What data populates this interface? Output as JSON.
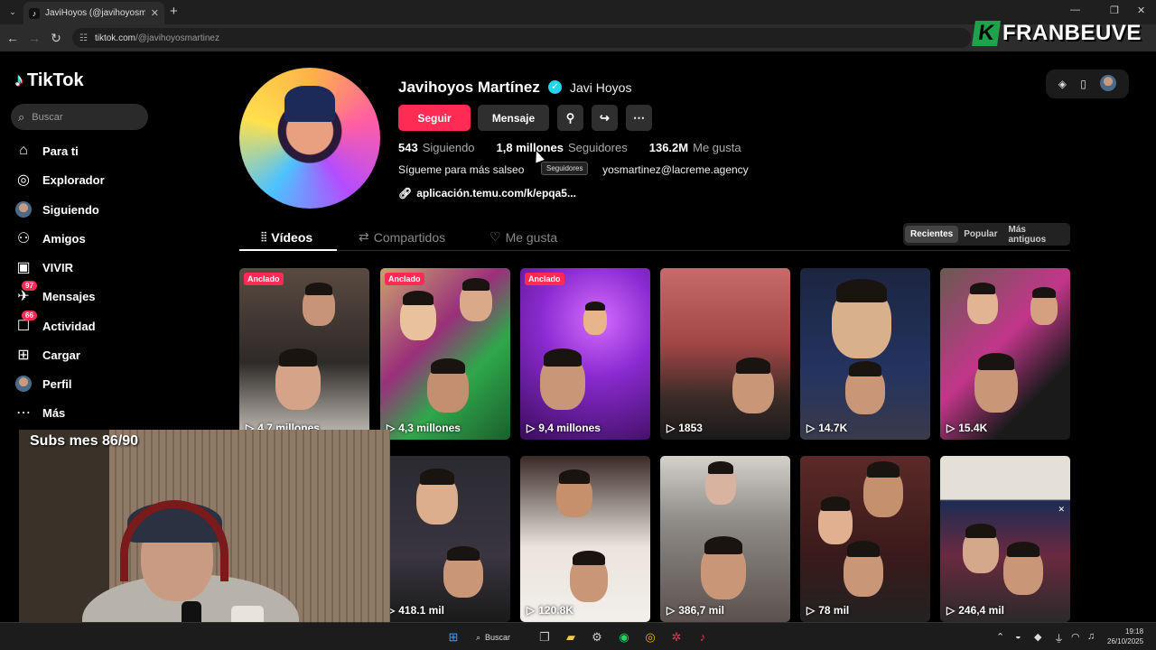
{
  "browser": {
    "tab_title": "JaviHoyos (@javihoyosmartinez",
    "url_host": "tiktok.com",
    "url_path": "/@javihoyosmartinez"
  },
  "overlay_brand": {
    "letter": "K",
    "name": "FRANBEUVE",
    "accent": "#1ea34a"
  },
  "sidebar": {
    "logo": "TikTok",
    "search_placeholder": "Buscar",
    "items": [
      {
        "label": "Para ti",
        "icon": "home-icon"
      },
      {
        "label": "Explorador",
        "icon": "compass-icon"
      },
      {
        "label": "Siguiendo",
        "icon": "avatar"
      },
      {
        "label": "Amigos",
        "icon": "friends-icon"
      },
      {
        "label": "VIVIR",
        "icon": "live-icon"
      },
      {
        "label": "Mensajes",
        "icon": "messages-icon",
        "badge": "97"
      },
      {
        "label": "Actividad",
        "icon": "activity-icon",
        "badge": "66"
      },
      {
        "label": "Cargar",
        "icon": "upload-icon"
      },
      {
        "label": "Perfil",
        "icon": "avatar"
      },
      {
        "label": "Más",
        "icon": "more-icon"
      }
    ]
  },
  "profile": {
    "name": "Javihoyos Martínez",
    "nickname": "Javi Hoyos",
    "follow": "Seguir",
    "message": "Mensaje",
    "stats": [
      {
        "num": "543",
        "label": "Siguiendo"
      },
      {
        "num": "1,8 millones",
        "label": "Seguidores"
      },
      {
        "num": "136.2M",
        "label": "Me gusta"
      }
    ],
    "bio_start": "Sígueme para más salseo",
    "bio_end": "yosmartinez@lacreme.agency",
    "tooltip": "Seguidores",
    "link": "aplicación.temu.com/k/epqa5..."
  },
  "tabs": {
    "videos": "Vídeos",
    "shared": "Compartidos",
    "liked": "Me gusta"
  },
  "sort": {
    "recent": "Recientes",
    "popular": "Popular",
    "oldest": "Más antiguos"
  },
  "pinned_label": "Anclado",
  "videos": [
    {
      "views": "4,7 millones"
    },
    {
      "views": "4,3 millones"
    },
    {
      "views": "9,4 millones"
    },
    {
      "views": "1853"
    },
    {
      "views": "14.7K"
    },
    {
      "views": "15.4K"
    },
    {
      "views": "418.1 mil"
    },
    {
      "views": "120.8K"
    },
    {
      "views": "386,7 mil"
    },
    {
      "views": "78 mil"
    },
    {
      "views": "246,4 mil"
    }
  ],
  "webcam": {
    "subs_text": "Subs mes 86/90"
  },
  "taskbar": {
    "search": "Buscar",
    "time": "19:18",
    "date": "26/10/2025"
  }
}
